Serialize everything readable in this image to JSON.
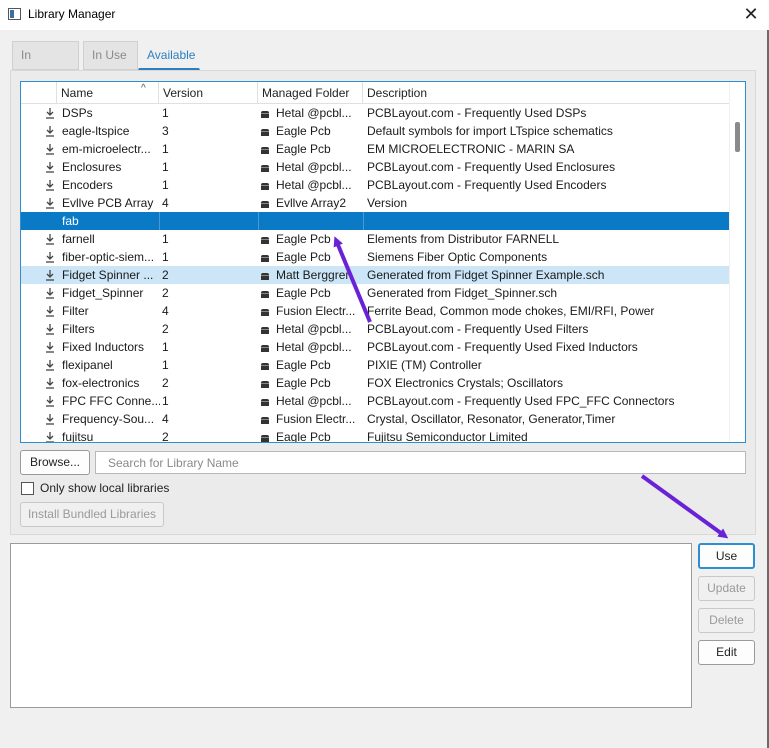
{
  "window": {
    "title": "Library Manager"
  },
  "tabs": [
    {
      "label": "In Design",
      "active": false
    },
    {
      "label": "In Use",
      "active": false
    },
    {
      "label": "Available",
      "active": true
    }
  ],
  "table": {
    "columns": [
      "Name",
      "Version",
      "Managed Folder",
      "Description"
    ],
    "rows": [
      {
        "download": true,
        "name": "DSPs",
        "version": "1",
        "folder": "Hetal @pcbl...",
        "description": "PCBLayout.com - Frequently Used DSPs"
      },
      {
        "download": true,
        "name": "eagle-ltspice",
        "version": "3",
        "folder": "Eagle Pcb",
        "description": "Default symbols for import LTspice schematics"
      },
      {
        "download": true,
        "name": "em-microelectr...",
        "version": "1",
        "folder": "Eagle Pcb",
        "description": "EM MICROELECTRONIC - MARIN SA"
      },
      {
        "download": true,
        "name": "Enclosures",
        "version": "1",
        "folder": "Hetal @pcbl...",
        "description": "PCBLayout.com - Frequently Used Enclosures"
      },
      {
        "download": true,
        "name": "Encoders",
        "version": "1",
        "folder": "Hetal @pcbl...",
        "description": "PCBLayout.com - Frequently Used Encoders"
      },
      {
        "download": true,
        "name": "Evllve PCB Array",
        "version": "4",
        "folder": "Evllve Array2",
        "description": "Version"
      },
      {
        "download": false,
        "name": "fab",
        "version": "",
        "folder": "",
        "description": "",
        "state": "selected"
      },
      {
        "download": true,
        "name": "farnell",
        "version": "1",
        "folder": "Eagle Pcb",
        "description": "Elements from Distributor FARNELL"
      },
      {
        "download": true,
        "name": "fiber-optic-siem...",
        "version": "1",
        "folder": "Eagle Pcb",
        "description": "Siemens Fiber Optic Components"
      },
      {
        "download": true,
        "name": "Fidget Spinner ...",
        "version": "2",
        "folder": "Matt Berggren",
        "description": "Generated from Fidget Spinner Example.sch",
        "state": "hover"
      },
      {
        "download": true,
        "name": "Fidget_Spinner",
        "version": "2",
        "folder": "Eagle Pcb",
        "description": "Generated from Fidget_Spinner.sch"
      },
      {
        "download": true,
        "name": "Filter",
        "version": "4",
        "folder": "Fusion Electr...",
        "description": "Ferrite Bead, Common mode chokes, EMI/RFI, Power"
      },
      {
        "download": true,
        "name": "Filters",
        "version": "2",
        "folder": "Hetal @pcbl...",
        "description": "PCBLayout.com - Frequently Used Filters"
      },
      {
        "download": true,
        "name": "Fixed Inductors",
        "version": "1",
        "folder": "Hetal @pcbl...",
        "description": "PCBLayout.com - Frequently Used Fixed Inductors"
      },
      {
        "download": true,
        "name": "flexipanel",
        "version": "1",
        "folder": "Eagle Pcb",
        "description": "PIXIE (TM) Controller"
      },
      {
        "download": true,
        "name": "fox-electronics",
        "version": "2",
        "folder": "Eagle Pcb",
        "description": "FOX Electronics Crystals; Oscillators"
      },
      {
        "download": true,
        "name": "FPC FFC Conne...",
        "version": "1",
        "folder": "Hetal @pcbl...",
        "description": "PCBLayout.com - Frequently Used FPC_FFC Connectors"
      },
      {
        "download": true,
        "name": "Frequency-Sou...",
        "version": "4",
        "folder": "Fusion Electr...",
        "description": "Crystal, Oscillator, Resonator, Generator,Timer"
      },
      {
        "download": true,
        "name": "fujitsu",
        "version": "2",
        "folder": "Eagle Pcb",
        "description": "Fujitsu Semiconductor Limited"
      }
    ]
  },
  "controls": {
    "browse_label": "Browse...",
    "search_placeholder": "Search for Library Name",
    "search_value": "",
    "only_local_label": "Only show local libraries",
    "only_local_checked": false,
    "install_bundled_label": "Install Bundled Libraries"
  },
  "actions": {
    "use_label": "Use",
    "update_label": "Update",
    "delete_label": "Delete",
    "edit_label": "Edit"
  },
  "colors": {
    "accent": "#2d8fd0",
    "selection": "#0a7ac7",
    "hover_row": "#cce6f7",
    "annotation_arrow": "#6a22d6"
  },
  "icons": {
    "download": "download-arrow-icon",
    "folder": "managed-folder-icon",
    "close": "close-icon",
    "sort": "sort-ascending-icon"
  }
}
